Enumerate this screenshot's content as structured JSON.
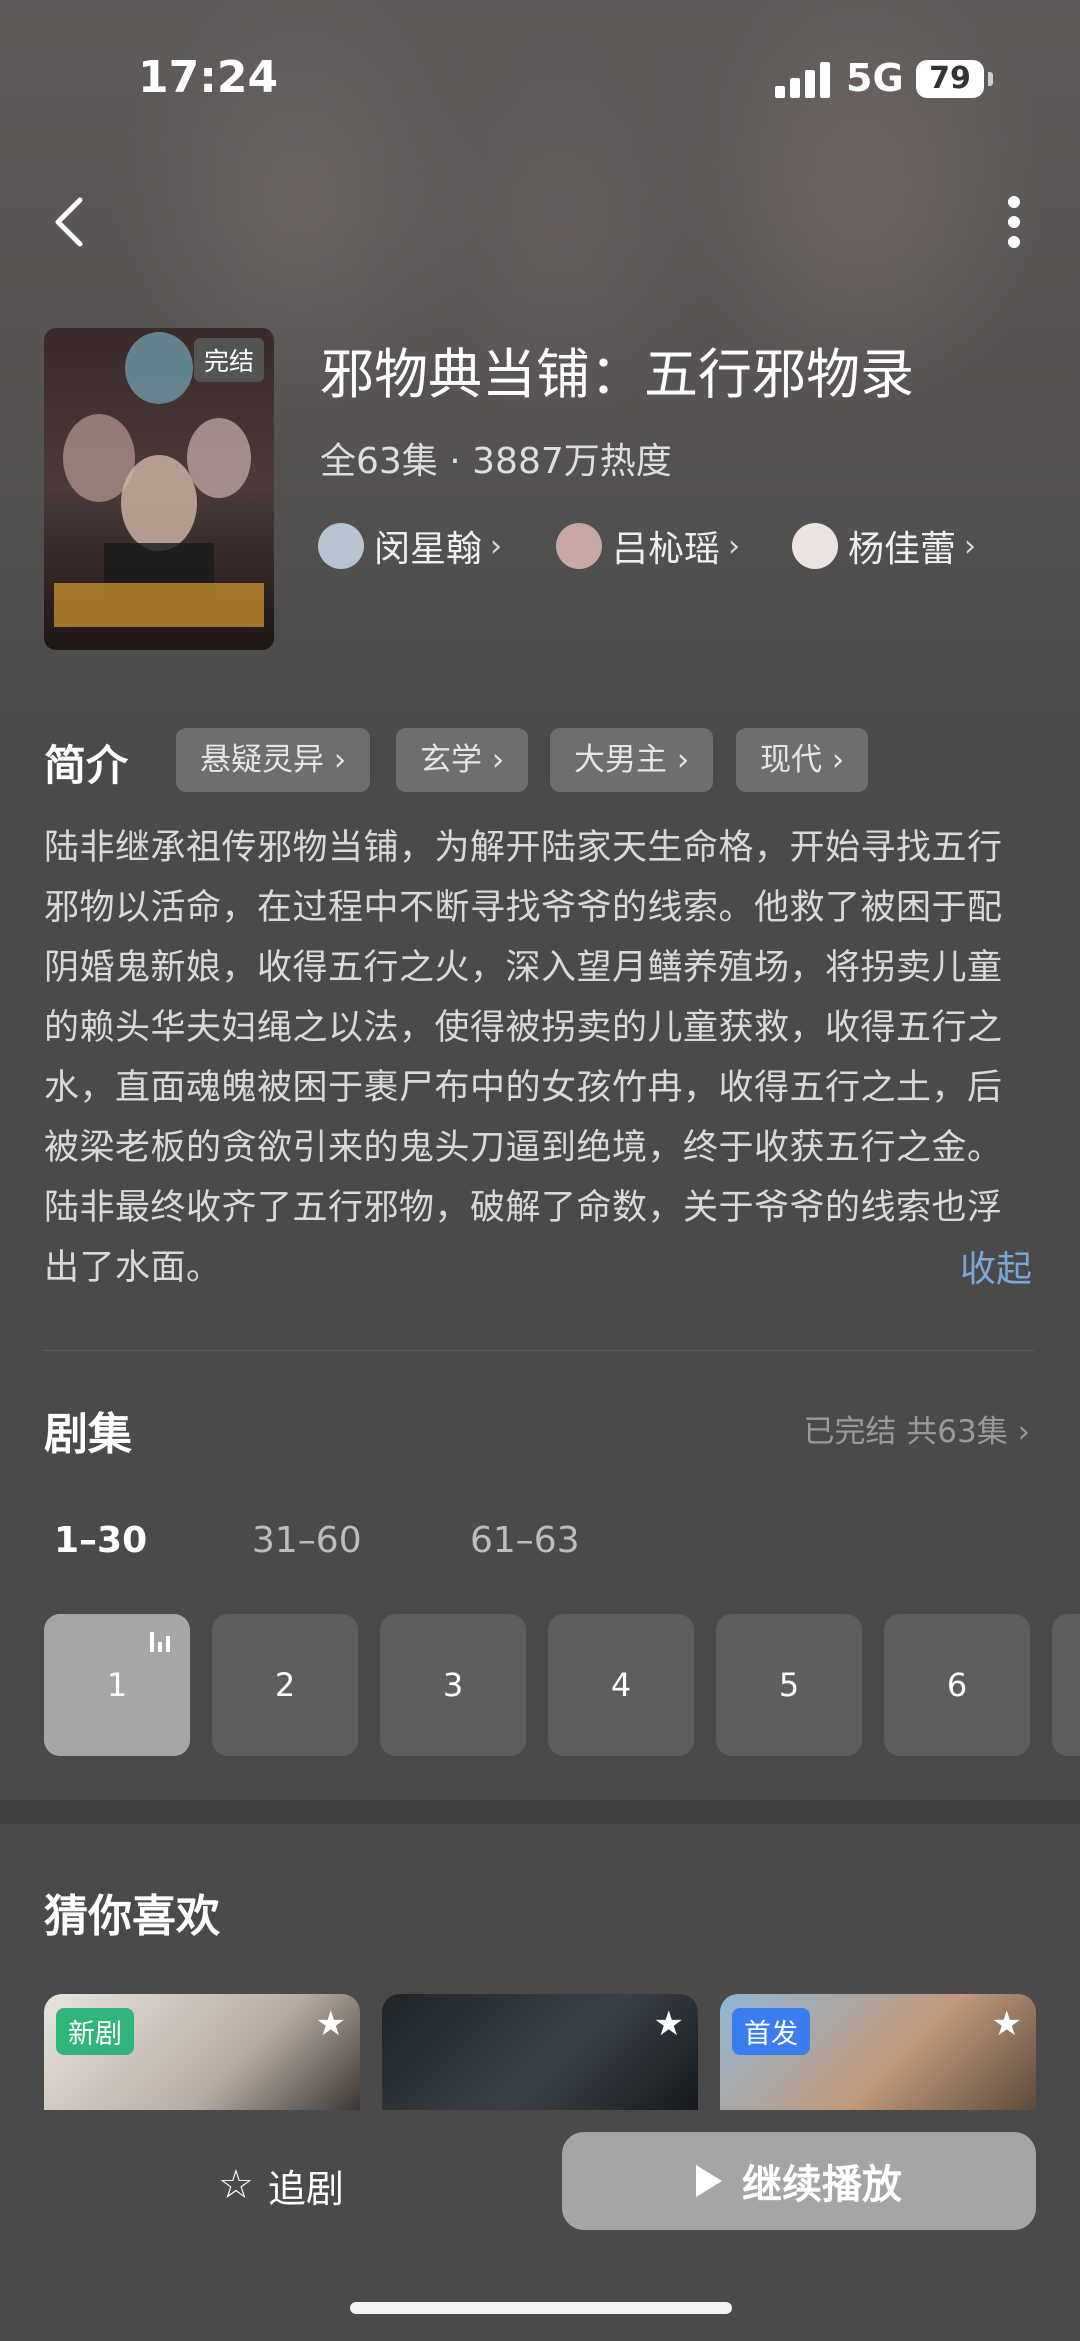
{
  "status_bar": {
    "time": "17:24",
    "network": "5G",
    "battery": "79"
  },
  "show": {
    "cover_badge": "完结",
    "title": "邪物典当铺：五行邪物录",
    "meta": "全63集 · 3887万热度",
    "cast": [
      {
        "name": "闵星翰"
      },
      {
        "name": "吕杺瑶"
      },
      {
        "name": "杨佳蕾"
      }
    ]
  },
  "intro": {
    "label": "简介",
    "tags": [
      "悬疑灵异",
      "玄学",
      "大男主",
      "现代"
    ],
    "synopsis": "陆非继承祖传邪物当铺，为解开陆家天生命格，开始寻找五行邪物以活命，在过程中不断寻找爷爷的线索。他救了被困于配阴婚鬼新娘，收得五行之火，深入望月鳝养殖场，将拐卖儿童的赖头华夫妇绳之以法，使得被拐卖的儿童获救，收得五行之水，直面魂魄被困于裹尸布中的女孩竹冉，收得五行之土，后被梁老板的贪欲引来的鬼头刀逼到绝境，终于收获五行之金。陆非最终收齐了五行邪物，破解了命数，关于爷爷的线索也浮出了水面。",
    "collapse": "收起"
  },
  "episodes": {
    "title": "剧集",
    "status": "已完结 共63集 ›",
    "ranges": [
      "1–30",
      "31–60",
      "61–63"
    ],
    "items": [
      "1",
      "2",
      "3",
      "4",
      "5",
      "6"
    ]
  },
  "recommend": {
    "title": "猜你喜欢",
    "badges": {
      "new": "新剧",
      "premiere": "首发"
    }
  },
  "bottom": {
    "follow": "追剧",
    "play": "继续播放"
  },
  "colors": {
    "accent_link": "#79a7d8",
    "new_badge": "#2fb57a",
    "premiere_badge": "#3b7cf0"
  }
}
